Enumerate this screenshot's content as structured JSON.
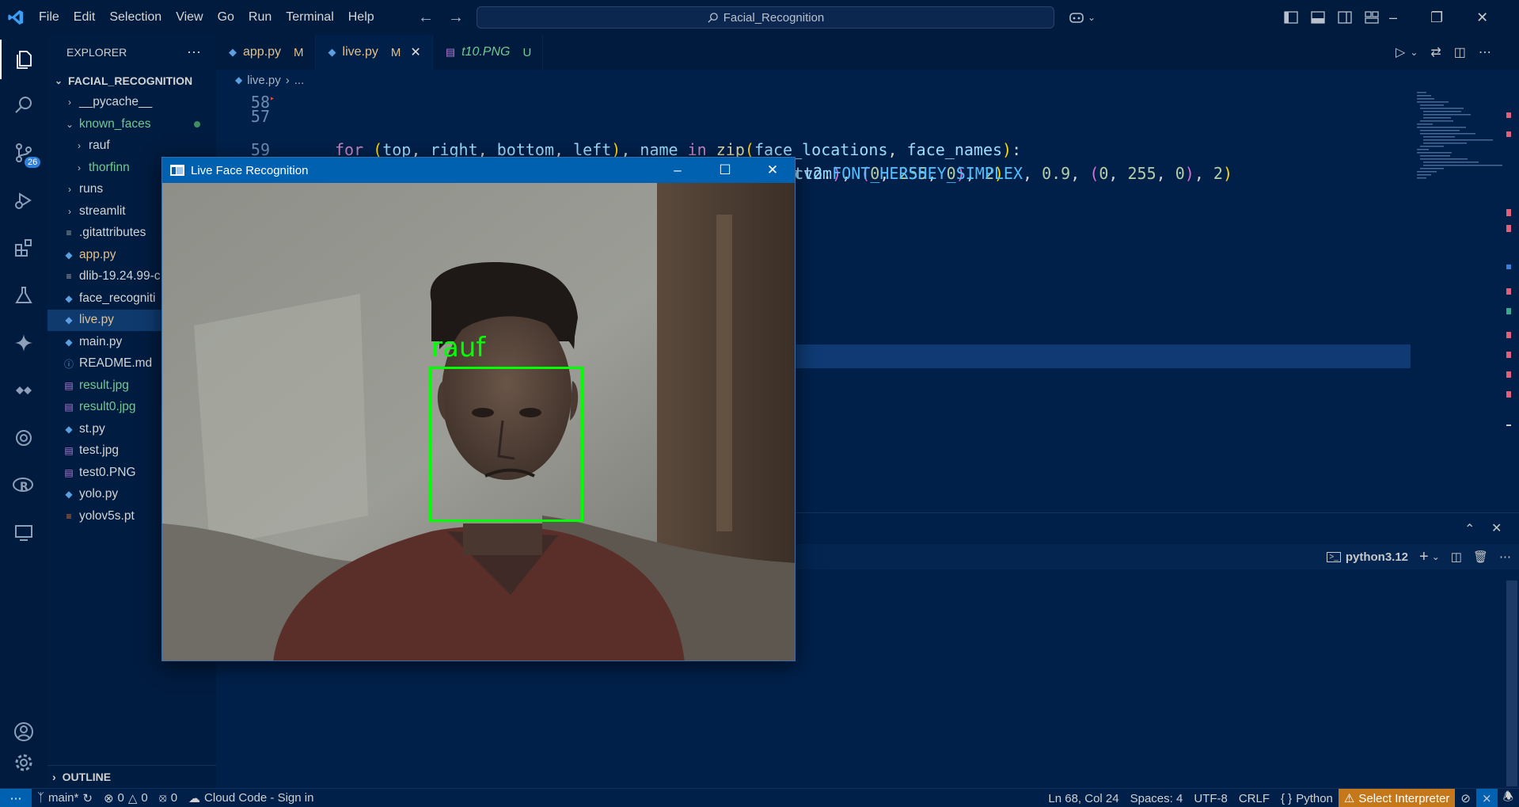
{
  "titlebar": {
    "menu": [
      "File",
      "Edit",
      "Selection",
      "View",
      "Go",
      "Run",
      "Terminal",
      "Help"
    ],
    "search_text": "Facial_Recognition"
  },
  "activity": {
    "scm_badge": "26"
  },
  "explorer": {
    "header": "EXPLORER",
    "root": "FACIAL_RECOGNITION",
    "items": [
      {
        "label": "__pycache__",
        "type": "folder",
        "indent": 1
      },
      {
        "label": "known_faces",
        "type": "folder-open",
        "indent": 1
      },
      {
        "label": "rauf",
        "type": "folder",
        "indent": 2
      },
      {
        "label": "thorfinn",
        "type": "folder",
        "indent": 2
      },
      {
        "label": "runs",
        "type": "folder",
        "indent": 1
      },
      {
        "label": "streamlit",
        "type": "folder",
        "indent": 1
      },
      {
        "label": ".gitattributes",
        "type": "file",
        "indent": 1
      },
      {
        "label": "app.py",
        "type": "py",
        "indent": 1
      },
      {
        "label": "dlib-19.24.99-c",
        "type": "file",
        "indent": 1
      },
      {
        "label": "face_recogniti",
        "type": "py",
        "indent": 1
      },
      {
        "label": "live.py",
        "type": "py",
        "indent": 1
      },
      {
        "label": "main.py",
        "type": "py",
        "indent": 1
      },
      {
        "label": "README.md",
        "type": "info",
        "indent": 1
      },
      {
        "label": "result.jpg",
        "type": "img",
        "indent": 1
      },
      {
        "label": "result0.jpg",
        "type": "img",
        "indent": 1
      },
      {
        "label": "st.py",
        "type": "py",
        "indent": 1
      },
      {
        "label": "test.jpg",
        "type": "img",
        "indent": 1
      },
      {
        "label": "test0.PNG",
        "type": "img",
        "indent": 1
      },
      {
        "label": "yolo.py",
        "type": "py",
        "indent": 1
      },
      {
        "label": "yolov5s.pt",
        "type": "rss",
        "indent": 1
      }
    ],
    "outline": "OUTLINE"
  },
  "tabs": [
    {
      "name": "app.py",
      "status": "M"
    },
    {
      "name": "live.py",
      "status": "M"
    },
    {
      "name": "t10.PNG",
      "status": "U"
    }
  ],
  "breadcrumb": {
    "file": "live.py",
    "rest": "..."
  },
  "code": {
    "line57": "57",
    "line58": "58",
    "line59": "59"
  },
  "terminal": {
    "shell": "python3.12"
  },
  "live_window": {
    "title": "Live Face Recognition",
    "face_label": "rauf"
  },
  "status": {
    "branch": "main*",
    "errors": "0",
    "warnings": "0",
    "ports": "0",
    "cloud": "Cloud Code - Sign in",
    "position": "Ln 68, Col 24",
    "spaces": "Spaces: 4",
    "encoding": "UTF-8",
    "eol": "CRLF",
    "language": "Python",
    "interpreter": "Select Interpreter"
  }
}
